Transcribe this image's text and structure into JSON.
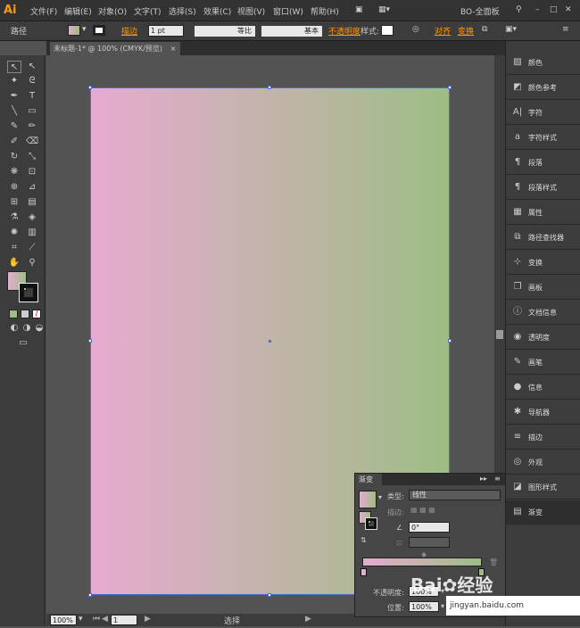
{
  "app": {
    "logo": "Ai",
    "workspace": "BO-全面板"
  },
  "menu": [
    "文件(F)",
    "编辑(E)",
    "对象(O)",
    "文字(T)",
    "选择(S)",
    "效果(C)",
    "视图(V)",
    "窗口(W)",
    "帮助(H)"
  ],
  "control": {
    "object": "路径",
    "stroke_label": "描边",
    "stroke_value": "1 pt",
    "stroke_profile": "等比",
    "brush": "基本",
    "opacity_label": "不透明度",
    "style_label": "样式:",
    "align": "对齐",
    "transform": "变换"
  },
  "document": {
    "tab": "未标题-1* @ 100% (CMYK/预览)",
    "gradient_start": "#e6abd0",
    "gradient_end": "#9ebd84"
  },
  "status": {
    "zoom": "100%",
    "page": "1",
    "tool": "选择"
  },
  "panels": [
    {
      "icon": "color-icon",
      "label": "颜色"
    },
    {
      "icon": "color-guide-icon",
      "label": "颜色参考"
    },
    {
      "icon": "character-icon",
      "label": "字符"
    },
    {
      "icon": "character-style-icon",
      "label": "字符样式"
    },
    {
      "icon": "paragraph-icon",
      "label": "段落"
    },
    {
      "icon": "paragraph-style-icon",
      "label": "段落样式"
    },
    {
      "icon": "attributes-icon",
      "label": "属性"
    },
    {
      "icon": "pathfinder-icon",
      "label": "路径查找器"
    },
    {
      "icon": "transform-icon",
      "label": "变换"
    },
    {
      "icon": "artboards-icon",
      "label": "画板"
    },
    {
      "icon": "document-info-icon",
      "label": "文档信息"
    },
    {
      "icon": "transparency-icon",
      "label": "透明度"
    },
    {
      "icon": "brushes-icon",
      "label": "画笔"
    },
    {
      "icon": "info-icon",
      "label": "信息"
    },
    {
      "icon": "navigator-icon",
      "label": "导航器"
    },
    {
      "icon": "stroke-icon",
      "label": "描边"
    },
    {
      "icon": "appearance-icon",
      "label": "外观"
    },
    {
      "icon": "graphic-styles-icon",
      "label": "图形样式"
    },
    {
      "icon": "gradient-icon",
      "label": "渐变"
    }
  ],
  "gradient_panel": {
    "title": "渐变",
    "type_label": "类型:",
    "type_value": "线性",
    "stroke_label": "描边:",
    "angle_value": "0°",
    "opacity_label": "不透明度:",
    "opacity_value": "100%",
    "location_label": "位置:",
    "location_value": "100%"
  },
  "watermark": {
    "brand": "Bai",
    "brand2": "经验",
    "url": "jingyan.baidu.com"
  }
}
